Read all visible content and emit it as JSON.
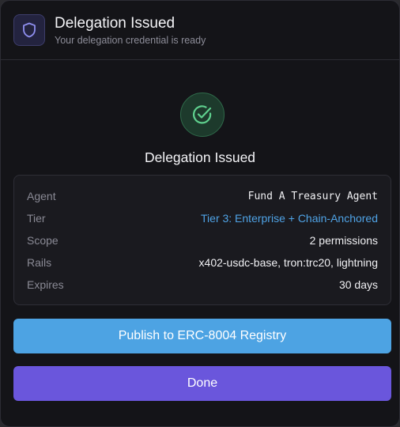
{
  "header": {
    "title": "Delegation Issued",
    "subtitle": "Your delegation credential is ready",
    "icon": "shield-icon"
  },
  "status": {
    "icon": "check-circle-icon",
    "title": "Delegation Issued",
    "color": "#5fd08e"
  },
  "details": {
    "agent": {
      "label": "Agent",
      "value": "Fund A Treasury Agent"
    },
    "tier": {
      "label": "Tier",
      "value": "Tier 3: Enterprise + Chain-Anchored",
      "color": "#4fa3e6"
    },
    "scope": {
      "label": "Scope",
      "value": "2 permissions"
    },
    "rails": {
      "label": "Rails",
      "value": "x402-usdc-base, tron:trc20, lightning"
    },
    "expires": {
      "label": "Expires",
      "value": "30 days"
    }
  },
  "actions": {
    "publish_label": "Publish to ERC-8004 Registry",
    "publish_color": "#4da3e3",
    "done_label": "Done",
    "done_color": "#6a56dc"
  }
}
